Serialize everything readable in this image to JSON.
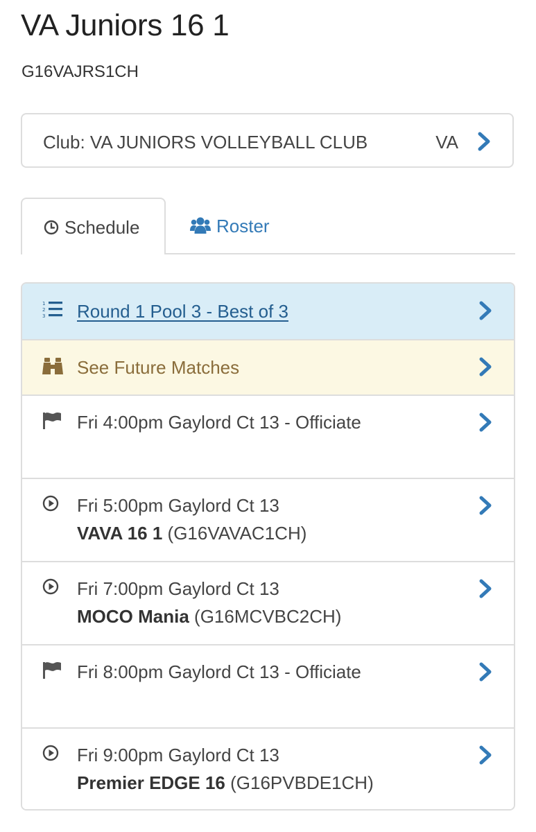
{
  "team": {
    "name": "VA Juniors 16 1",
    "code": "G16VAJRS1CH"
  },
  "club": {
    "label": "Club: VA JUNIORS VOLLEYBALL CLUB",
    "state": "VA"
  },
  "tabs": {
    "schedule": "Schedule",
    "roster": "Roster"
  },
  "schedule": {
    "pool_link": "Round 1 Pool 3 - Best of 3",
    "future_matches": "See Future Matches",
    "matches": [
      {
        "type": "officiate",
        "time": "Fri 4:00pm Gaylord Ct 13 - Officiate",
        "opponent": "",
        "opponent_code": ""
      },
      {
        "type": "play",
        "time": "Fri 5:00pm Gaylord Ct 13",
        "opponent": "VAVA 16 1",
        "opponent_code": "(G16VAVAC1CH)"
      },
      {
        "type": "play",
        "time": "Fri 7:00pm Gaylord Ct 13",
        "opponent": "MOCO Mania",
        "opponent_code": "(G16MCVBC2CH)"
      },
      {
        "type": "officiate",
        "time": "Fri 8:00pm Gaylord Ct 13 - Officiate",
        "opponent": "",
        "opponent_code": ""
      },
      {
        "type": "play",
        "time": "Fri 9:00pm Gaylord Ct 13",
        "opponent": "Premier EDGE 16",
        "opponent_code": "(G16PVBDE1CH)"
      }
    ]
  },
  "icons": {
    "chevron": "chevron-right-icon",
    "schedule_tab": "clock-icon",
    "roster_tab": "users-icon",
    "pool": "ordered-list-icon",
    "future": "binoculars-icon",
    "officiate": "flag-icon",
    "play": "play-circle-icon"
  },
  "colors": {
    "link_blue": "#337ab7",
    "info_bg": "#d9edf7",
    "warning_bg": "#fcf8e3",
    "warning_text": "#8a6d3b",
    "border": "#dddddd"
  }
}
